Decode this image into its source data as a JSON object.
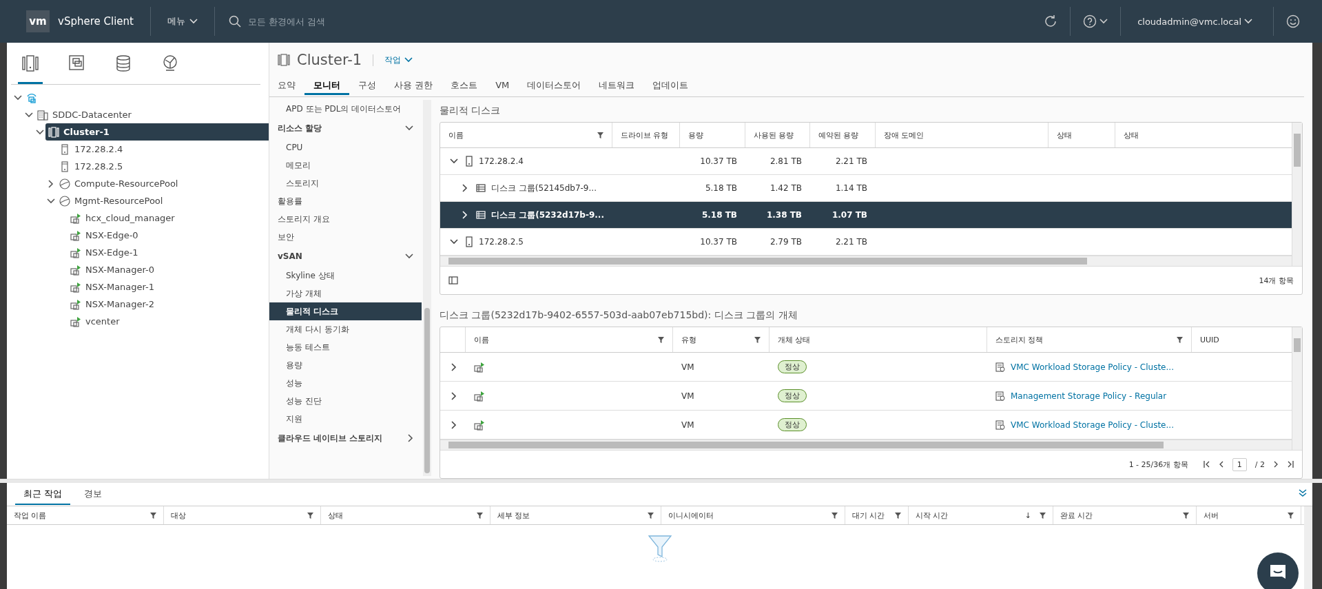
{
  "header": {
    "logo": "vm",
    "product": "vSphere Client",
    "menu": "메뉴",
    "search_placeholder": "모든 환경에서 검색",
    "user": "cloudadmin@vmc.local"
  },
  "inventory_tabs": [
    {
      "kind": "hosts",
      "selected": true
    },
    {
      "kind": "vms",
      "selected": false
    },
    {
      "kind": "storage",
      "selected": false
    },
    {
      "kind": "network",
      "selected": false
    }
  ],
  "tree": [
    {
      "kind": "vcenter",
      "expanded": true,
      "selected": false,
      "children": [
        {
          "label": "SDDC-Datacenter",
          "kind": "datacenter",
          "expanded": true,
          "selected": false,
          "children": [
            {
              "label": "Cluster-1",
              "kind": "cluster",
              "expanded": true,
              "selected": true,
              "children": [
                {
                  "label": "172.28.2.4",
                  "kind": "host",
                  "selected": false
                },
                {
                  "label": "172.28.2.5",
                  "kind": "host",
                  "selected": false
                },
                {
                  "label": "Compute-ResourcePool",
                  "kind": "pool",
                  "expanded": false,
                  "selected": false
                },
                {
                  "label": "Mgmt-ResourcePool",
                  "kind": "pool",
                  "expanded": true,
                  "selected": false,
                  "children": [
                    {
                      "label": "hcx_cloud_manager",
                      "kind": "vm",
                      "selected": false
                    },
                    {
                      "label": "NSX-Edge-0",
                      "kind": "vm",
                      "selected": false
                    },
                    {
                      "label": "NSX-Edge-1",
                      "kind": "vm",
                      "selected": false
                    },
                    {
                      "label": "NSX-Manager-0",
                      "kind": "vm",
                      "selected": false
                    },
                    {
                      "label": "NSX-Manager-1",
                      "kind": "vm",
                      "selected": false
                    },
                    {
                      "label": "NSX-Manager-2",
                      "kind": "vm",
                      "selected": false
                    },
                    {
                      "label": "vcenter",
                      "kind": "vm",
                      "selected": false
                    }
                  ]
                }
              ]
            }
          ]
        }
      ]
    }
  ],
  "object": {
    "title": "Cluster-1",
    "actions": "작업",
    "tabs": [
      {
        "label": "요약",
        "selected": false
      },
      {
        "label": "모니터",
        "selected": true
      },
      {
        "label": "구성",
        "selected": false
      },
      {
        "label": "사용 권한",
        "selected": false
      },
      {
        "label": "호스트",
        "selected": false
      },
      {
        "label": "VM",
        "selected": false
      },
      {
        "label": "데이터스토어",
        "selected": false
      },
      {
        "label": "네트워크",
        "selected": false
      },
      {
        "label": "업데이트",
        "selected": false
      }
    ]
  },
  "nav": [
    {
      "label": "APD 또는 PDL의 데이터스토어",
      "kind": "sub",
      "selected": false
    },
    {
      "label": "리소스 할당",
      "kind": "section",
      "expanded": true,
      "selected": false
    },
    {
      "label": "CPU",
      "kind": "sub",
      "selected": false
    },
    {
      "label": "메모리",
      "kind": "sub",
      "selected": false
    },
    {
      "label": "스토리지",
      "kind": "sub",
      "selected": false
    },
    {
      "label": "활용률",
      "kind": "link",
      "selected": false
    },
    {
      "label": "스토리지 개요",
      "kind": "link",
      "selected": false
    },
    {
      "label": "보안",
      "kind": "link",
      "selected": false
    },
    {
      "label": "vSAN",
      "kind": "section",
      "expanded": true,
      "selected": false
    },
    {
      "label": "Skyline 상태",
      "kind": "sub",
      "selected": false
    },
    {
      "label": "가상 개체",
      "kind": "sub",
      "selected": false
    },
    {
      "label": "물리적 디스크",
      "kind": "sub",
      "selected": true
    },
    {
      "label": "개체 다시 동기화",
      "kind": "sub",
      "selected": false
    },
    {
      "label": "능동 테스트",
      "kind": "sub",
      "selected": false
    },
    {
      "label": "용량",
      "kind": "sub",
      "selected": false
    },
    {
      "label": "성능",
      "kind": "sub",
      "selected": false
    },
    {
      "label": "성능 진단",
      "kind": "sub",
      "selected": false
    },
    {
      "label": "지원",
      "kind": "sub",
      "selected": false
    },
    {
      "label": "클라우드 네이티브 스토리지",
      "kind": "section",
      "expanded": false,
      "selected": false
    }
  ],
  "disks": {
    "title": "물리적 디스크",
    "columns": [
      {
        "label": "이름",
        "filter": true
      },
      {
        "label": "드라이브 유형",
        "filter": false
      },
      {
        "label": "용량",
        "filter": false
      },
      {
        "label": "사용된 용량",
        "filter": false
      },
      {
        "label": "예약된 용량",
        "filter": false
      },
      {
        "label": "장애 도메인",
        "filter": false
      },
      {
        "label": "상태",
        "filter": false
      },
      {
        "label": "상태",
        "filter": false
      }
    ],
    "rows": [
      {
        "kind": "host",
        "name": "172.28.2.4",
        "capacity": "10.37 TB",
        "used": "2.81 TB",
        "reserved": "2.21 TB",
        "expanded": true,
        "selected": false
      },
      {
        "kind": "diskgroup",
        "name": "디스크 그룹(52145db7-9...",
        "capacity": "5.18 TB",
        "used": "1.42 TB",
        "reserved": "1.14 TB",
        "expanded": false,
        "selected": false
      },
      {
        "kind": "diskgroup",
        "name": "디스크 그룹(5232d17b-9...",
        "capacity": "5.18 TB",
        "used": "1.38 TB",
        "reserved": "1.07 TB",
        "expanded": false,
        "selected": true
      },
      {
        "kind": "host",
        "name": "172.28.2.5",
        "capacity": "10.37 TB",
        "used": "2.79 TB",
        "reserved": "2.21 TB",
        "expanded": true,
        "selected": false
      }
    ],
    "count": "14개 항목"
  },
  "objects": {
    "title": "디스크 그룹(5232d17b-9402-6557-503d-aab07eb715bd): 디스크 그룹의 개체",
    "columns": [
      {
        "label": "이름",
        "filter": true
      },
      {
        "label": "유형",
        "filter": true
      },
      {
        "label": "개체 상태",
        "filter": false
      },
      {
        "label": "스토리지 정책",
        "filter": true
      },
      {
        "label": "UUID",
        "filter": false
      }
    ],
    "rows": [
      {
        "type": "VM",
        "status": "정상",
        "policy": "VMC Workload Storage Policy - Cluste..."
      },
      {
        "type": "VM",
        "status": "정상",
        "policy": "Management Storage Policy - Regular"
      },
      {
        "type": "VM",
        "status": "정상",
        "policy": "VMC Workload Storage Policy - Cluste..."
      }
    ],
    "range": "1 - 25/36개 항목",
    "page": "1",
    "pages": "/ 2"
  },
  "tasks": {
    "tabs": [
      {
        "label": "최근 작업",
        "selected": true
      },
      {
        "label": "경보",
        "selected": false
      }
    ],
    "columns": [
      {
        "label": "작업 이름"
      },
      {
        "label": "대상"
      },
      {
        "label": "상태"
      },
      {
        "label": "세부 정보"
      },
      {
        "label": "이니시에이터"
      },
      {
        "label": "대기 시간"
      },
      {
        "label": "시작 시간",
        "sort": "↓"
      },
      {
        "label": "완료 시간"
      },
      {
        "label": "서버"
      }
    ]
  }
}
